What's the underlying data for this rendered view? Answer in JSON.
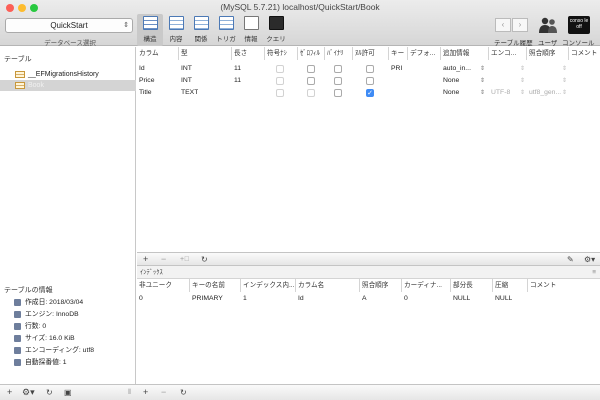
{
  "window": {
    "title": "(MySQL 5.7.21) localhost/QuickStart/Book"
  },
  "toolbar": {
    "database": "QuickStart",
    "database_label": "データベース選択",
    "buttons": [
      {
        "label": "構造",
        "icon": "structure-icon"
      },
      {
        "label": "内容",
        "icon": "content-icon"
      },
      {
        "label": "関係",
        "icon": "relations-icon"
      },
      {
        "label": "トリガ",
        "icon": "triggers-icon"
      },
      {
        "label": "情報",
        "icon": "info-icon"
      },
      {
        "label": "クエリ",
        "icon": "query-icon"
      }
    ],
    "history_label": "テーブル履歴",
    "users_label": "ユーザ",
    "console_label": "コンソール",
    "console_badge": "conso le off"
  },
  "sidebar": {
    "tables_header": "テーブル",
    "tables": [
      "__EFMigrationsHistory",
      "Book"
    ],
    "info_header": "テーブルの情報",
    "info": [
      "作成日: 2018/03/04",
      "エンジン: InnoDB",
      "行数: 0",
      "サイズ: 16.0 KiB",
      "エンコーディング: utf8",
      "自動採番値: 1"
    ]
  },
  "structure": {
    "headers": [
      "カラム",
      "型",
      "長さ",
      "符号ﾅｼ",
      "ｾﾞﾛﾌｨﾙ",
      "ﾊﾞｲﾅﾘ",
      "ﾇﾙ許可",
      "キー",
      "デフォ...",
      "追加情報",
      "エンコ...",
      "照合順序",
      "コメント"
    ],
    "rows": [
      {
        "name": "Id",
        "type": "INT",
        "length": "11",
        "key": "PRI",
        "default": "",
        "extra": "auto_in...",
        "encoding": "",
        "collation": "",
        "null_checked": false
      },
      {
        "name": "Price",
        "type": "INT",
        "length": "11",
        "key": "",
        "default": "",
        "extra": "None",
        "encoding": "",
        "collation": "",
        "null_checked": false
      },
      {
        "name": "Title",
        "type": "TEXT",
        "length": "",
        "key": "",
        "default": "",
        "extra": "None",
        "encoding": "UTF-8",
        "collation": "utf8_gen...",
        "null_checked": true
      }
    ]
  },
  "indexes": {
    "label": "ｲﾝﾃﾞｯｸｽ",
    "headers": [
      "非ユニーク",
      "キーの名前",
      "インデックス内...",
      "カラム名",
      "照合順序",
      "カーディナ...",
      "部分長",
      "圧縮",
      "コメント"
    ],
    "rows": [
      [
        "0",
        "PRIMARY",
        "1",
        "Id",
        "A",
        "0",
        "NULL",
        "NULL",
        ""
      ]
    ]
  }
}
